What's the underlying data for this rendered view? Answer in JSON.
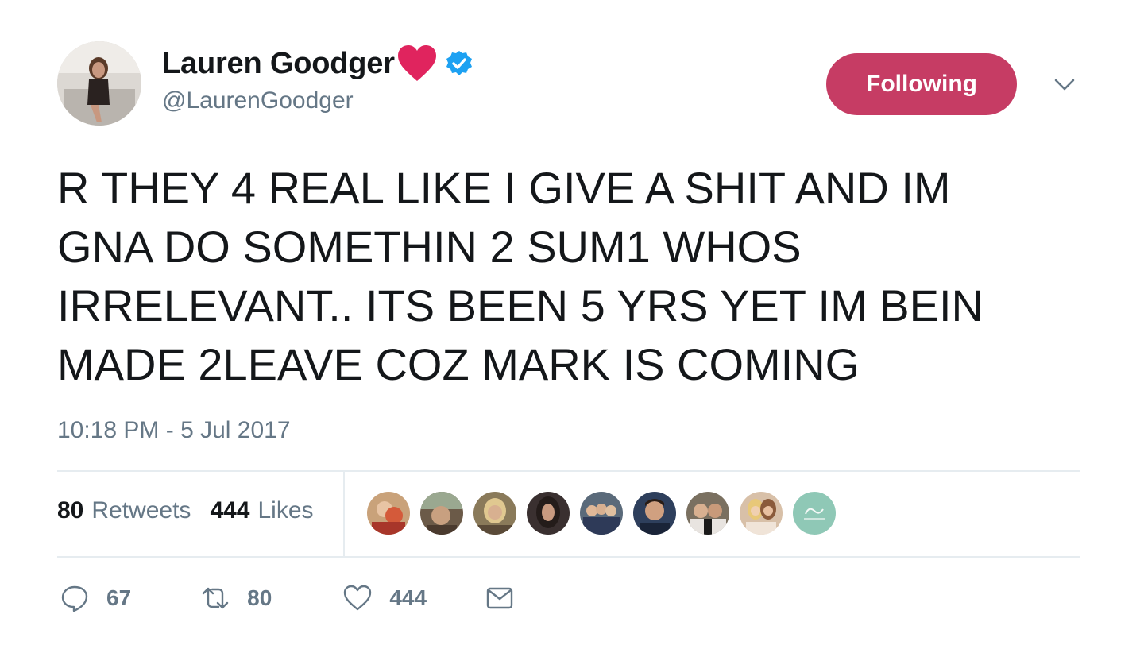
{
  "user": {
    "display_name": "Lauren Goodger",
    "handle": "@LaurenGoodger",
    "verified": true
  },
  "follow_button": {
    "label": "Following",
    "color": "#c63c64"
  },
  "tweet": {
    "text_lines": [
      "R THEY 4 REAL LIKE I GIVE A SHIT AND IM",
      "GNA DO SOMETHIN 2 SUM1 WHOS",
      "IRRELEVANT.. ITS BEEN 5 YRS YET IM BEIN",
      "MADE 2LEAVE COZ MARK IS COMING"
    ],
    "timestamp": "10:18 PM - 5 Jul 2017"
  },
  "stats": {
    "retweets_count": "80",
    "retweets_label": "Retweets",
    "likes_count": "444",
    "likes_label": "Likes"
  },
  "liker_avatars": [
    {
      "color": "#c9a27a"
    },
    {
      "color": "#6b5a48"
    },
    {
      "color": "#8a7a5a"
    },
    {
      "color": "#3a3030"
    },
    {
      "color": "#5a6a7a"
    },
    {
      "color": "#2e3f5c"
    },
    {
      "color": "#7a7060"
    },
    {
      "color": "#d8c0a8"
    },
    {
      "color": "#8fc8b6"
    }
  ],
  "actions": {
    "replies": "67",
    "retweets": "80",
    "likes": "444"
  },
  "colors": {
    "accent": "#c63c64",
    "verified": "#1da1f2",
    "heart": "#e0245e",
    "secondary_text": "#657786"
  },
  "icons": [
    "heart-icon",
    "verified-badge-icon",
    "chevron-down-icon",
    "reply-icon",
    "retweet-icon",
    "like-icon",
    "direct-message-icon"
  ]
}
